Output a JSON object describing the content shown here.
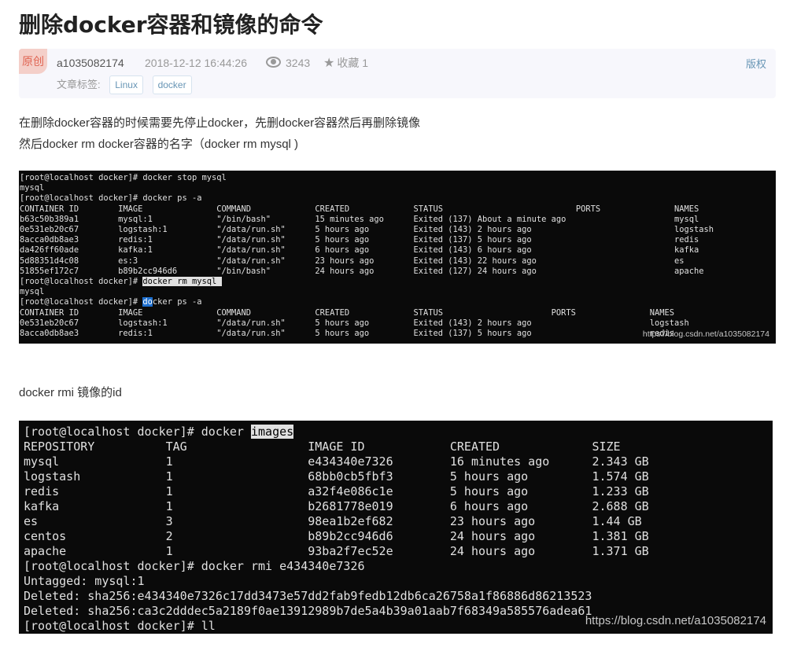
{
  "article": {
    "title": "删除docker容器和镜像的命令",
    "badge": "原创",
    "author": "a1035082174",
    "date": "2018-12-12 16:44:26",
    "views": "3243",
    "favorite_label": "收藏 1",
    "copyright_label": "版权",
    "tags_label": "文章标签:",
    "tags": [
      "Linux",
      "docker"
    ]
  },
  "content": {
    "para1": "在删除docker容器的时候需要先停止docker，先删docker容器然后再删除镜像",
    "para2": "然后docker rm docker容器的名字（docker rm mysql )",
    "para3": "docker rmi 镜像的id"
  },
  "terminal1": {
    "line1": "[root@localhost docker]# docker stop mysql",
    "line2": "mysql",
    "line3": "[root@localhost docker]# docker ps -a",
    "line4": "CONTAINER ID        IMAGE               COMMAND             CREATED             STATUS                           PORTS               NAMES",
    "line5": "b63c50b389a1        mysql:1             \"/bin/bash\"         15 minutes ago      Exited (137) About a minute ago                      mysql",
    "line6": "0e531eb20c67        logstash:1          \"/data/run.sh\"      5 hours ago         Exited (143) 2 hours ago                             logstash",
    "line7": "8acca0db8ae3        redis:1             \"/data/run.sh\"      5 hours ago         Exited (137) 5 hours ago                             redis",
    "line8": "da426ff60ade        kafka:1             \"/data/run.sh\"      6 hours ago         Exited (143) 6 hours ago                             kafka",
    "line9": "5d88351d4c08        es:3                \"/data/run.sh\"      23 hours ago        Exited (143) 22 hours ago                            es",
    "line10": "51855ef172c7        b89b2cc946d6        \"/bin/bash\"         24 hours ago        Exited (127) 24 hours ago                            apache",
    "line11_prompt": "[root@localhost docker]# ",
    "line11_cmd": "docker rm mysql ",
    "line12": "mysql",
    "line13_prompt": "[root@localhost docker]# ",
    "line13_cursor": "do",
    "line13_rest": "cker ps -a",
    "line14": "CONTAINER ID        IMAGE               COMMAND             CREATED             STATUS                      PORTS               NAMES",
    "line15": "0e531eb20c67        logstash:1          \"/data/run.sh\"      5 hours ago         Exited (143) 2 hours ago                        logstash",
    "line16": "8acca0db8ae3        redis:1             \"/data/run.sh\"      5 hours ago         Exited (137) 5 hours ago                        redis",
    "watermark": "https://blog.csdn.net/a1035082174"
  },
  "terminal2": {
    "line1_prompt": "[root@localhost docker]# docker ",
    "line1_hl": "images",
    "line2": "REPOSITORY          TAG                 IMAGE ID            CREATED             SIZE",
    "line3": "mysql               1                   e434340e7326        16 minutes ago      2.343 GB",
    "line4": "logstash            1                   68bb0cb5fbf3        5 hours ago         1.574 GB",
    "line5": "redis               1                   a32f4e086c1e        5 hours ago         1.233 GB",
    "line6": "kafka               1                   b2681778e019        6 hours ago         2.688 GB",
    "line7": "es                  3                   98ea1b2ef682        23 hours ago        1.44 GB",
    "line8": "centos              2                   b89b2cc946d6        24 hours ago        1.381 GB",
    "line9": "apache              1                   93ba2f7ec52e        24 hours ago        1.371 GB",
    "line10": "[root@localhost docker]# docker rmi e434340e7326",
    "line11": "Untagged: mysql:1",
    "line12": "Deleted: sha256:e434340e7326c17dd3473e57dd2fab9fedb12db6ca26758a1f86886d86213523",
    "line13": "Deleted: sha256:ca3c2dddec5a2189f0ae13912989b7de5a4b39a01aab7f68349a585576adea61",
    "line14": "[root@localhost docker]# ll",
    "watermark": "https://blog.csdn.net/a1035082174"
  }
}
